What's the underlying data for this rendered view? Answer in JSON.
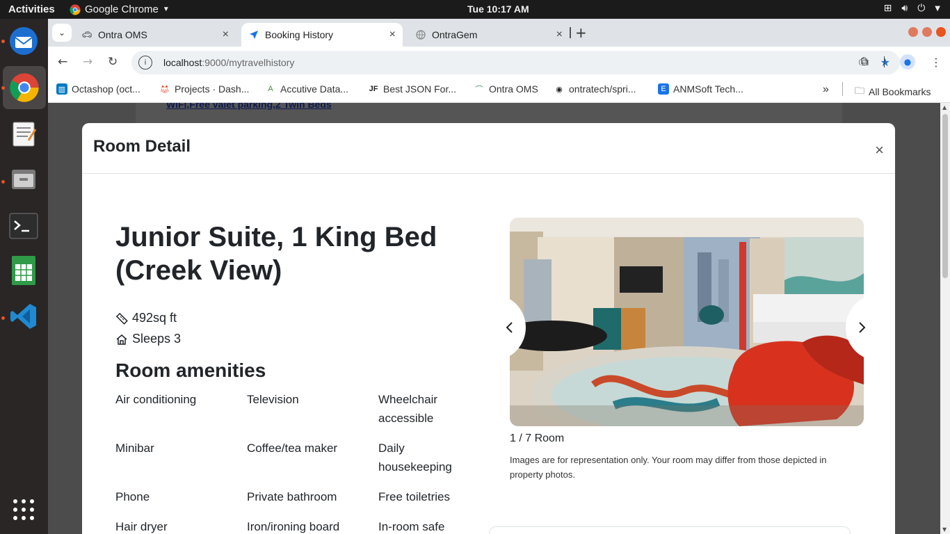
{
  "topbar": {
    "activities": "Activities",
    "app_name": "Google Chrome",
    "clock": "Tue 10:17 AM"
  },
  "dock": {
    "items": [
      "thunderbird-icon",
      "chrome-icon",
      "text-editor-icon",
      "file-manager-icon",
      "terminal-icon",
      "spreadsheet-icon",
      "vscode-icon",
      "app-grid-icon"
    ]
  },
  "browser": {
    "tabs": [
      {
        "title": "Ontra OMS"
      },
      {
        "title": "Booking History"
      },
      {
        "title": "OntraGem"
      }
    ],
    "url_host": "localhost",
    "url_rest": ":9000/mytravelhistory",
    "bookmarks": [
      {
        "label": "Octashop (oct..."
      },
      {
        "label": "Projects · Dash..."
      },
      {
        "label": "Accutive Data..."
      },
      {
        "label": "Best JSON For..."
      },
      {
        "label": "Ontra OMS"
      },
      {
        "label": "ontratech/spri..."
      },
      {
        "label": "ANMSoft Tech..."
      }
    ],
    "all_bookmarks": "All Bookmarks",
    "more_bookmarks": "»"
  },
  "background_page": {
    "link_text": "WiFi,Free valet parking,2 Twin Beds"
  },
  "modal": {
    "title": "Room Detail",
    "close_glyph": "×",
    "room_name": "Junior Suite, 1 King Bed (Creek View)",
    "size": "492sq ft",
    "sleeps": "Sleeps 3",
    "amenities_title": "Room amenities",
    "amenities": [
      "Air conditioning",
      "Television",
      "Wheelchair accessible",
      "Minibar",
      "Coffee/tea maker",
      "Daily housekeeping",
      "Phone",
      "Private bathroom",
      "Free toiletries",
      "Hair dryer",
      "Iron/ironing board",
      "In-room safe"
    ],
    "gallery": {
      "caption": "1 / 7 Room",
      "note": "Images are for representation only. Your room may differ from those depicted in property photos.",
      "prev_glyph": "‹",
      "next_glyph": "›"
    }
  }
}
